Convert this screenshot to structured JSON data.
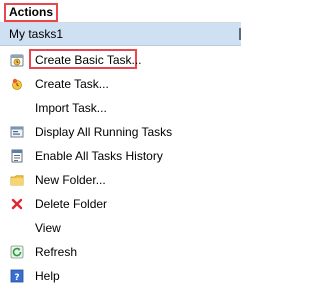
{
  "panel": {
    "title": "Actions",
    "group_label": "My tasks1"
  },
  "menu": {
    "items": [
      {
        "label": "Create Basic Task...",
        "icon": "create-basic-task-icon"
      },
      {
        "label": "Create Task...",
        "icon": "create-task-icon"
      },
      {
        "label": "Import Task...",
        "icon": ""
      },
      {
        "label": "Display All Running Tasks",
        "icon": "running-tasks-icon"
      },
      {
        "label": "Enable All Tasks History",
        "icon": "task-history-icon"
      },
      {
        "label": "New Folder...",
        "icon": "folder-icon"
      },
      {
        "label": "Delete Folder",
        "icon": "delete-icon"
      },
      {
        "label": "View",
        "icon": ""
      },
      {
        "label": "Refresh",
        "icon": "refresh-icon"
      },
      {
        "label": "Help",
        "icon": "help-icon"
      }
    ]
  },
  "colors": {
    "highlight_border": "#e8474d",
    "group_background": "#cfe0f2"
  }
}
